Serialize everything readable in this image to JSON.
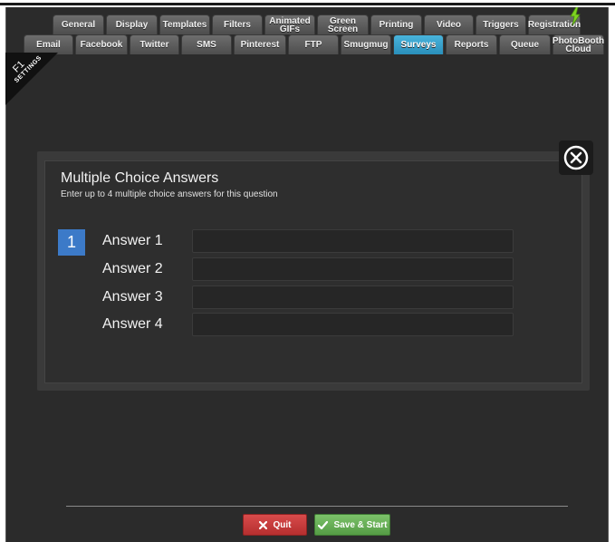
{
  "tabs_row1": [
    {
      "label": "General",
      "active": false
    },
    {
      "label": "Display",
      "active": false
    },
    {
      "label": "Templates",
      "active": false
    },
    {
      "label": "Filters",
      "active": false
    },
    {
      "label": "Animated\nGIFs",
      "active": false
    },
    {
      "label": "Green\nScreen",
      "active": false
    },
    {
      "label": "Printing",
      "active": false
    },
    {
      "label": "Video",
      "active": false
    },
    {
      "label": "Triggers",
      "active": false
    },
    {
      "label": "Registration",
      "active": false
    }
  ],
  "tabs_row2": [
    {
      "label": "Email",
      "active": false
    },
    {
      "label": "Facebook",
      "active": false
    },
    {
      "label": "Twitter",
      "active": false
    },
    {
      "label": "SMS",
      "active": false
    },
    {
      "label": "Pinterest",
      "active": false
    },
    {
      "label": "FTP",
      "active": false
    },
    {
      "label": "Smugmug",
      "active": false
    },
    {
      "label": "Surveys",
      "active": true
    },
    {
      "label": "Reports",
      "active": false
    },
    {
      "label": "Queue",
      "active": false
    },
    {
      "label": "PhotoBooth\nCloud",
      "active": false
    }
  ],
  "corner": {
    "key": "F1",
    "label": "SETTINGS"
  },
  "dialog": {
    "title": "Multiple Choice Answers",
    "subtitle": "Enter up to 4 multiple choice answers for this question",
    "question_number": "1",
    "answers": [
      {
        "label": "Answer 1",
        "value": ""
      },
      {
        "label": "Answer 2",
        "value": ""
      },
      {
        "label": "Answer 3",
        "value": ""
      },
      {
        "label": "Answer 4",
        "value": ""
      }
    ]
  },
  "footer": {
    "quit_label": "Quit",
    "save_label": "Save & Start"
  },
  "colors": {
    "active_tab": "#3a9fcb",
    "badge": "#3c7ac8",
    "quit": "#c23b3b",
    "save": "#67ad55"
  },
  "icons": {
    "close": "close-circle-icon",
    "quit": "x-icon",
    "save": "checkmark-icon",
    "registration": "lightning-download-icon"
  }
}
